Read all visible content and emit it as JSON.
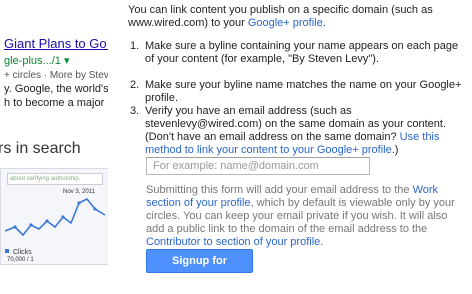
{
  "preview": {
    "link_text": "Giant Plans to Go S",
    "url_text": "gle-plus.../1",
    "url_arrow": "▾",
    "circles_text": "+ circles · More by Steven",
    "snippet_line1": "y. Google, the world's",
    "snippet_line2": "h to become a major"
  },
  "left_section": {
    "heading": "rs in search",
    "graph_search_label": "about verifying authorship.",
    "graph_date": "Nov 3, 2011",
    "graph_clicks_label": "Clicks",
    "graph_ratio": "70,000 / 1"
  },
  "main": {
    "intro_text_1": "You can link content you publish on a specific domain (such as www.wired.com) to your ",
    "intro_link": "Google+ profile",
    "intro_text_2": ".",
    "steps": [
      {
        "num": "1.",
        "text": "Make sure a byline containing your name appears on each page of your content (for example, \"By Steven Levy\")."
      },
      {
        "num": "2.",
        "text": "Make sure your byline name matches the name on your Google+ profile."
      },
      {
        "num": "3.",
        "text": "Verify you have an email address (such as stevenlevy@wired.com) on the same domain as your content. (Don't have an email address on the same domain? ",
        "link": "Use this method to link your content to your Google+ profile",
        "text_after": ".)"
      }
    ],
    "email_placeholder": "For example: name@domain.com",
    "note_part1": "Submitting this form will add your email address to the ",
    "note_link1": "Work section of your profile",
    "note_part2": ", which by default is viewable only by your circles. You can keep your email private if you wish. It will also add a public link to the domain of the email address to the ",
    "note_link2": "Contributor to section of your profile",
    "note_part3": ".",
    "button_label": "Signup for Authorship"
  },
  "colors": {
    "link": "#2a66c9",
    "button": "#4d90fe",
    "graph_line": "#3c78d8"
  }
}
